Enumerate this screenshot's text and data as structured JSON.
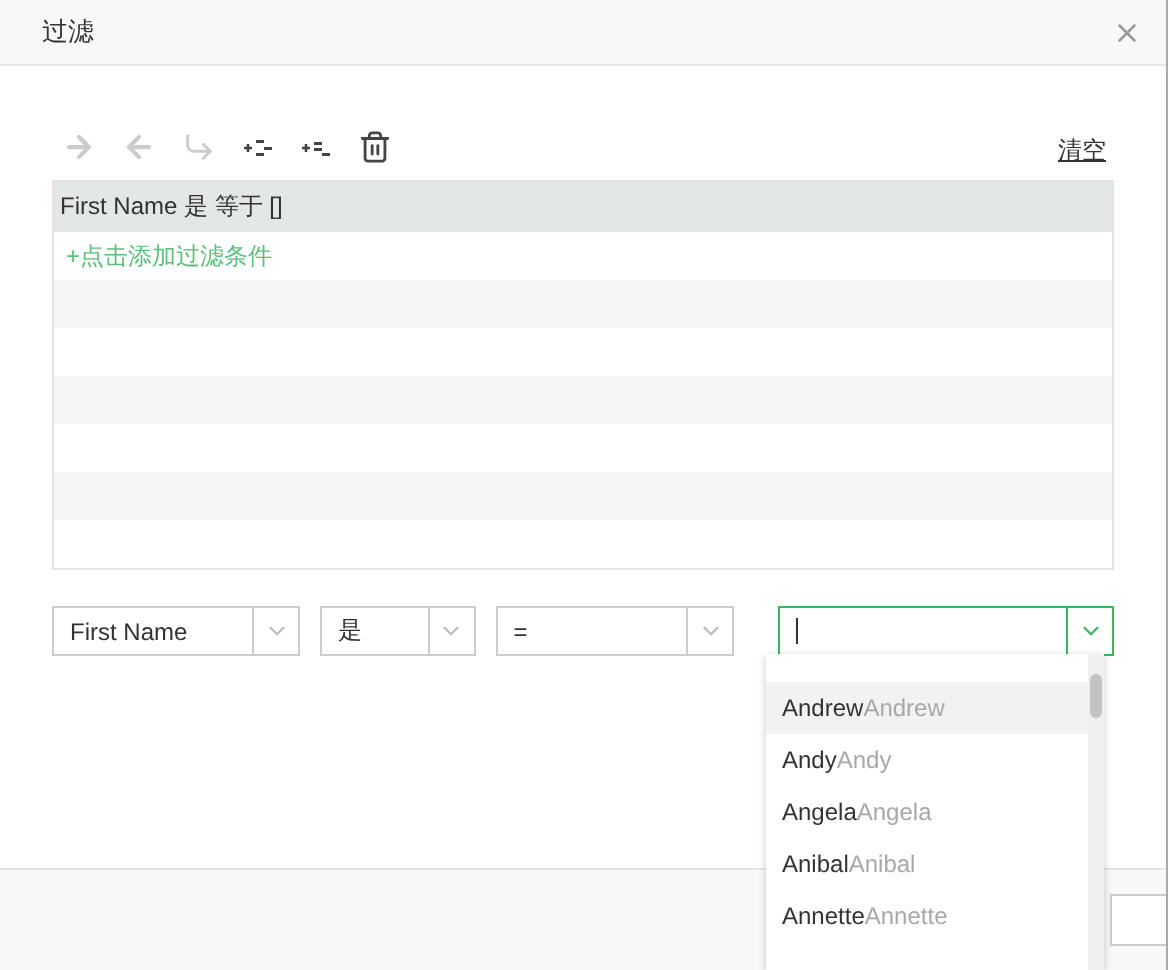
{
  "window": {
    "title": "过滤"
  },
  "toolbar": {
    "clear_link": "清空"
  },
  "table": {
    "header": "First Name 是 等于 []",
    "add_link": "+点击添加过滤条件"
  },
  "filter": {
    "field": "First Name",
    "operator": "是",
    "comparison": "="
  },
  "dropdown": {
    "items": [
      {
        "name": "Andrew",
        "hint": "Andrew",
        "selected": true
      },
      {
        "name": "Andy",
        "hint": "Andy",
        "selected": false
      },
      {
        "name": "Angela",
        "hint": "Angela",
        "selected": false
      },
      {
        "name": "Anibal",
        "hint": "Anibal",
        "selected": false
      },
      {
        "name": "Annette",
        "hint": "Annette",
        "selected": false
      }
    ]
  }
}
